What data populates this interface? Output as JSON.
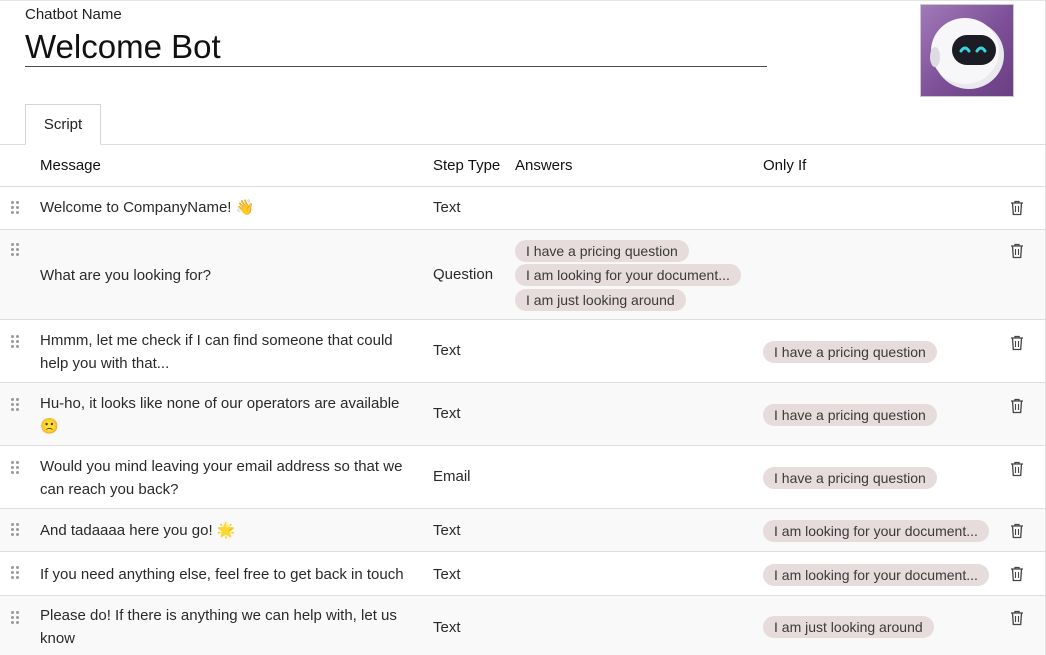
{
  "header": {
    "name_label": "Chatbot Name",
    "name_value": "Welcome Bot"
  },
  "tabs": {
    "script": "Script"
  },
  "columns": {
    "message": "Message",
    "step_type": "Step Type",
    "answers": "Answers",
    "only_if": "Only If"
  },
  "rows": [
    {
      "message": "Welcome to CompanyName! 👋",
      "type": "Text",
      "answers": [],
      "only_if": ""
    },
    {
      "message": "What are you looking for?",
      "type": "Question",
      "answers": [
        "I have a pricing question",
        "I am looking for your document...",
        "I am just looking around"
      ],
      "only_if": ""
    },
    {
      "message": "Hmmm, let me check if I can find someone that could help you with that...",
      "type": "Text",
      "answers": [],
      "only_if": "I have a pricing question"
    },
    {
      "message": "Hu-ho, it looks like none of our operators are available 🙁",
      "type": "Text",
      "answers": [],
      "only_if": "I have a pricing question"
    },
    {
      "message": "Would you mind leaving your email address so that we can reach you back?",
      "type": "Email",
      "answers": [],
      "only_if": "I have a pricing question"
    },
    {
      "message": "And tadaaaa here you go! 🌟",
      "type": "Text",
      "answers": [],
      "only_if": "I am looking for your document..."
    },
    {
      "message": "If you need anything else, feel free to get back in touch",
      "type": "Text",
      "answers": [],
      "only_if": "I am looking for your document..."
    },
    {
      "message": "Please do! If there is anything we can help with, let us know",
      "type": "Text",
      "answers": [],
      "only_if": "I am just looking around"
    }
  ],
  "icons": {
    "drag": "drag-handle-icon",
    "delete": "trash-icon",
    "avatar": "robot-avatar"
  },
  "colors": {
    "pill_bg": "#e6dcdc",
    "avatar_bg": "#8a5aa3"
  }
}
